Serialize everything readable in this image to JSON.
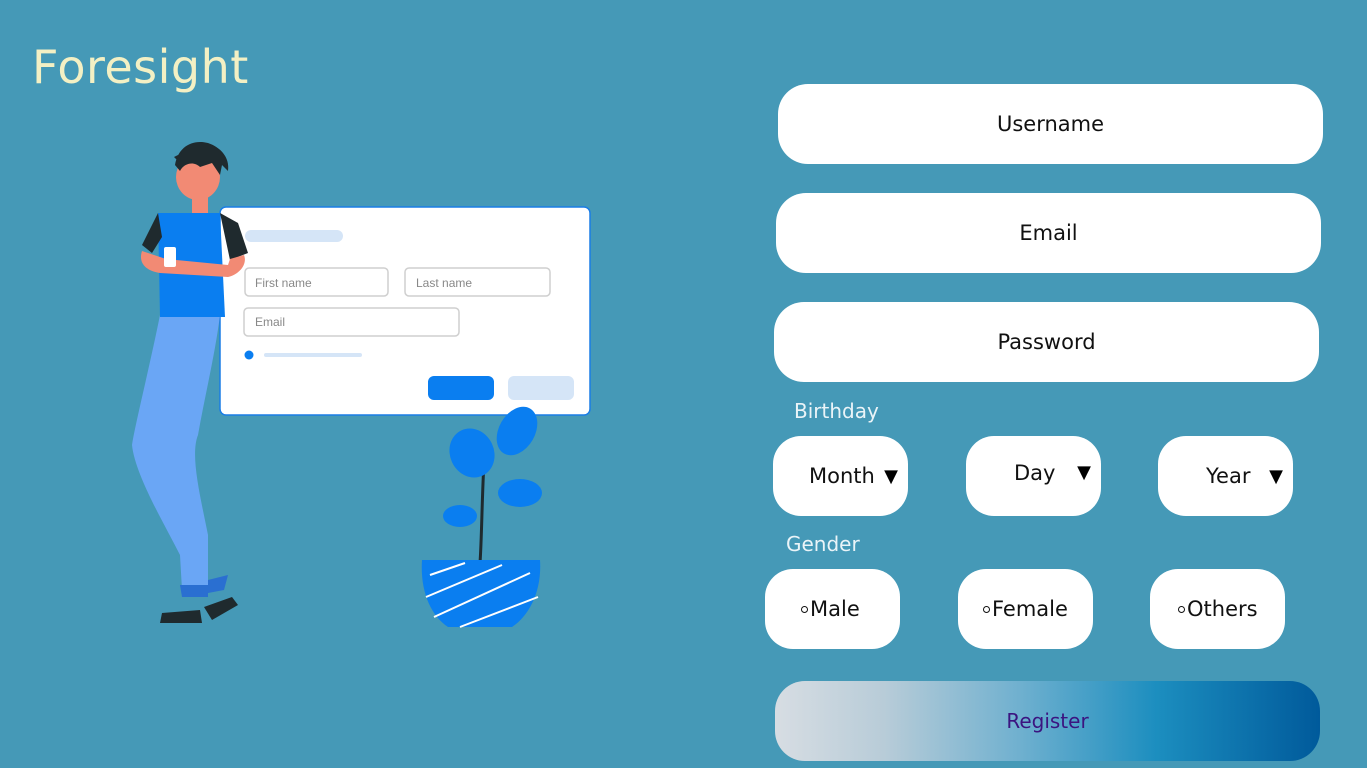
{
  "brand": {
    "name": "Foresight"
  },
  "colors": {
    "background": "#4599b7",
    "brand_text": "#f3f0c4",
    "accent_blue": "#0a7ef0",
    "register_text": "#3b1480"
  },
  "illustration": {
    "first_name_placeholder": "First name",
    "last_name_placeholder": "Last name",
    "email_placeholder": "Email"
  },
  "form": {
    "username_placeholder": "Username",
    "email_placeholder": "Email",
    "password_placeholder": "Password",
    "birthday_label": "Birthday",
    "month_label": "Month",
    "day_label": "Day",
    "year_label": "Year",
    "caret_glyph": "▼",
    "gender_label": "Gender",
    "gender_options": [
      "Male",
      "Female",
      "Others"
    ],
    "register_label": "Register"
  }
}
